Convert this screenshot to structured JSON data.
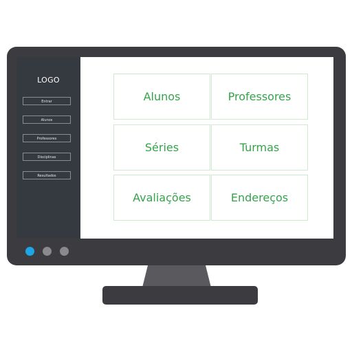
{
  "sidebar": {
    "logo": "LOGO",
    "items": [
      {
        "label": "Entrar"
      },
      {
        "label": "Alunos"
      },
      {
        "label": "Professores"
      },
      {
        "label": "Disciplinas"
      },
      {
        "label": "Resultados"
      }
    ]
  },
  "tiles": [
    {
      "label": "Alunos"
    },
    {
      "label": "Professores"
    },
    {
      "label": "Séries"
    },
    {
      "label": "Turmas"
    },
    {
      "label": "Avaliações"
    },
    {
      "label": "Endereços"
    }
  ],
  "colors": {
    "bezel": "#3c3b40",
    "sidebar": "#353a40",
    "accent_text": "#34a44a",
    "tile_border": "#cfe8cf",
    "active_dot": "#1ea5e6",
    "inactive_dot": "#8a8a8d"
  },
  "monitor_dots": [
    "active",
    "inactive",
    "inactive"
  ]
}
